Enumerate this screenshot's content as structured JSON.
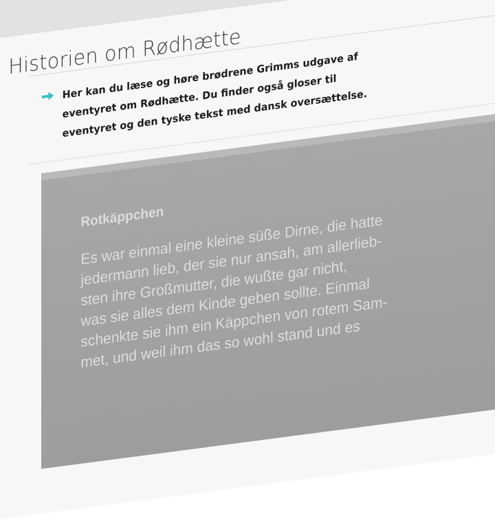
{
  "page": {
    "title": "Historien om Rødhætte"
  },
  "intro": {
    "text": "Her kan du læse og høre brødrene Grimms udgave af eventyret om Rødhætte. Du finder også gloser til eventyret og den tyske tekst med dansk oversættelse.",
    "icon": "arrow-right-icon",
    "icon_color": "#3bbfc4"
  },
  "story_image": {
    "title": "Rotkäppchen",
    "lines": [
      "Es war einmal eine kleine süße Dirne, die hatte",
      "jedermann lieb, der sie nur ansah, am allerlieb-",
      "sten ihre Großmutter, die wußte gar nicht,",
      "was sie alles dem Kinde geben sollte. Einmal",
      "schenkte sie ihm ein Käppchen von rotem Sam-",
      "met, und weil ihm das so wohl stand und es"
    ]
  },
  "colors": {
    "background": "#f7f7f7",
    "title_text": "#3a3a3a",
    "intro_text": "#1c1c1c",
    "image_gray": "#a3a3a3"
  }
}
